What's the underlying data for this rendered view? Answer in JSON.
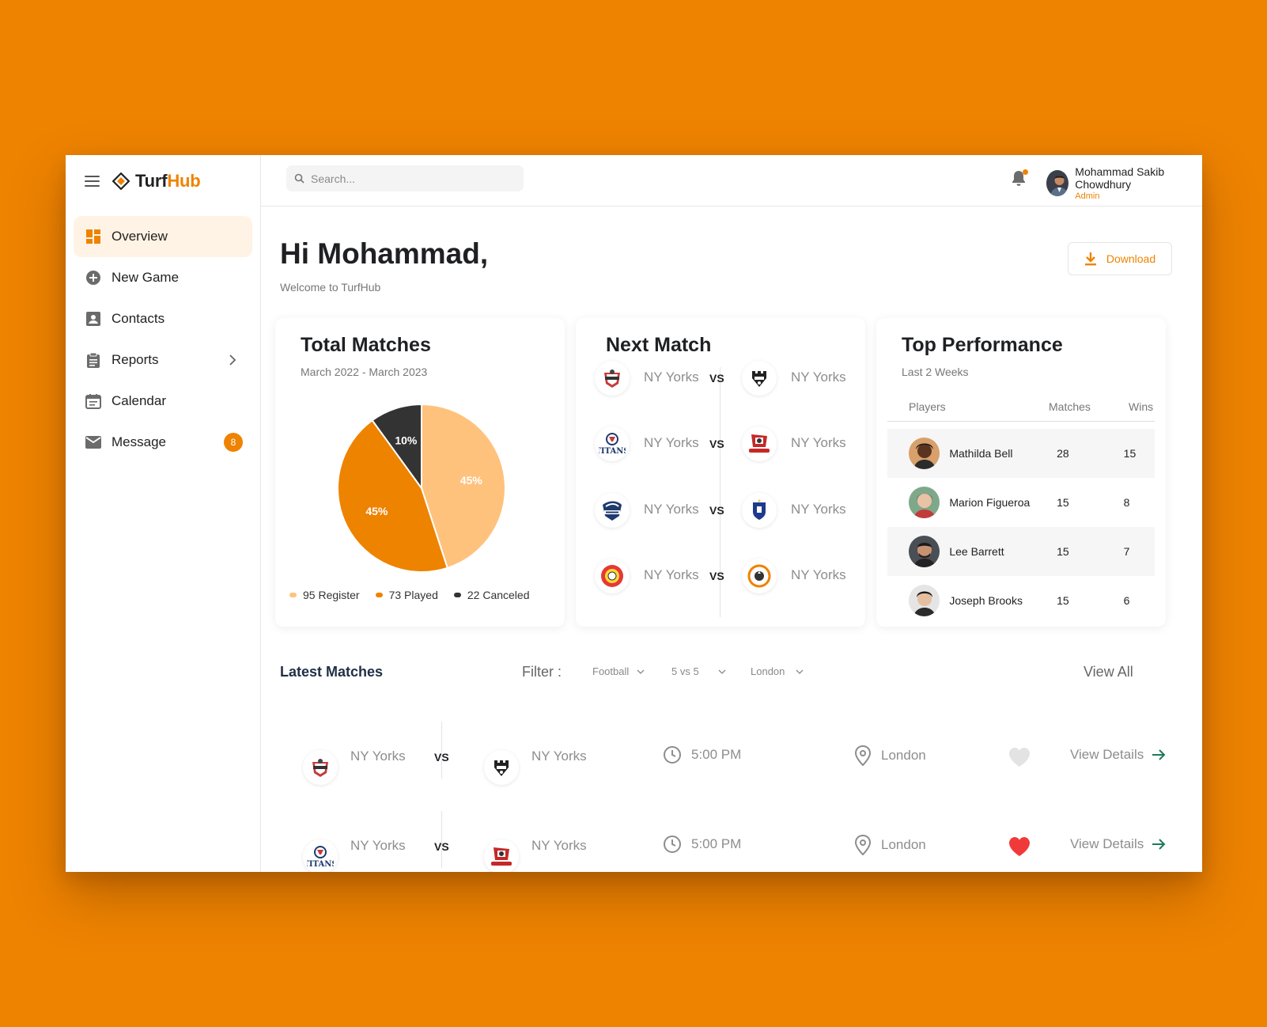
{
  "brand": {
    "name_a": "Turf",
    "name_b": "Hub"
  },
  "nav": [
    {
      "label": "Overview",
      "icon": "dashboard-icon",
      "active": true
    },
    {
      "label": "New Game",
      "icon": "plus-circle-icon"
    },
    {
      "label": "Contacts",
      "icon": "contact-card-icon"
    },
    {
      "label": "Reports",
      "icon": "clipboard-icon",
      "has_submenu": true
    },
    {
      "label": "Calendar",
      "icon": "calendar-icon"
    },
    {
      "label": "Message",
      "icon": "mail-icon",
      "badge": "8"
    }
  ],
  "search": {
    "placeholder": "Search..."
  },
  "user": {
    "name": "Mohammad Sakib Chowdhury",
    "role": "Admin"
  },
  "greeting": {
    "title": "Hi Mohammad,",
    "subtitle": "Welcome to TurfHub"
  },
  "download_label": "Download",
  "total_matches": {
    "title": "Total Matches",
    "range": "March 2022 - March 2023",
    "legend": [
      {
        "label": "95 Register",
        "color": "#FFC27D"
      },
      {
        "label": "73 Played",
        "color": "#EE8300"
      },
      {
        "label": "22 Canceled",
        "color": "#333333"
      }
    ]
  },
  "chart_data": {
    "type": "pie",
    "slices": [
      {
        "label": "Register",
        "percent": 45,
        "display": "45%",
        "color": "#FFC27D"
      },
      {
        "label": "Played",
        "percent": 45,
        "display": "45%",
        "color": "#EE8300"
      },
      {
        "label": "Canceled",
        "percent": 10,
        "display": "10%",
        "color": "#333333"
      }
    ]
  },
  "next_match": {
    "title": "Next Match",
    "matches": [
      {
        "home": "NY Yorks",
        "away": "NY Yorks",
        "vs": "VS",
        "home_logo": "shield-crest-logo",
        "away_logo": "castle-crest-logo"
      },
      {
        "home": "NY Yorks",
        "away": "NY Yorks",
        "vs": "VS",
        "home_logo": "titans-logo",
        "away_logo": "buccaneers-logo"
      },
      {
        "home": "NY Yorks",
        "away": "NY Yorks",
        "vs": "VS",
        "home_logo": "football-eagle-logo",
        "away_logo": "blue-shield-logo"
      },
      {
        "home": "NY Yorks",
        "away": "NY Yorks",
        "vs": "VS",
        "home_logo": "red-ball-logo",
        "away_logo": "orange-ball-logo"
      }
    ]
  },
  "top_performance": {
    "title": "Top Performance",
    "period": "Last 2 Weeks",
    "headers": {
      "players": "Players",
      "matches": "Matches",
      "wins": "Wins"
    },
    "rows": [
      {
        "name": "Mathilda Bell",
        "matches": "28",
        "wins": "15"
      },
      {
        "name": "Marion Figueroa",
        "matches": "15",
        "wins": "8"
      },
      {
        "name": "Lee Barrett",
        "matches": "15",
        "wins": "7"
      },
      {
        "name": "Joseph Brooks",
        "matches": "15",
        "wins": "6"
      }
    ]
  },
  "latest_matches": {
    "title": "Latest Matches",
    "filter_label": "Filter :",
    "filters": [
      "Football",
      "5 vs 5",
      "London"
    ],
    "view_all": "View All",
    "rows": [
      {
        "home": "NY Yorks",
        "away": "NY Yorks",
        "vs": "VS",
        "time": "5:00 PM",
        "location": "London",
        "favorite": false,
        "details": "View Details"
      },
      {
        "home": "NY Yorks",
        "away": "NY Yorks",
        "vs": "VS",
        "time": "5:00 PM",
        "location": "London",
        "favorite": true,
        "details": "View Details"
      }
    ]
  },
  "colors": {
    "accent": "#EE8300",
    "accent_light": "#FFC27D",
    "dark": "#333333",
    "heart": "#F03A3A",
    "arrow": "#1E7A5A"
  }
}
